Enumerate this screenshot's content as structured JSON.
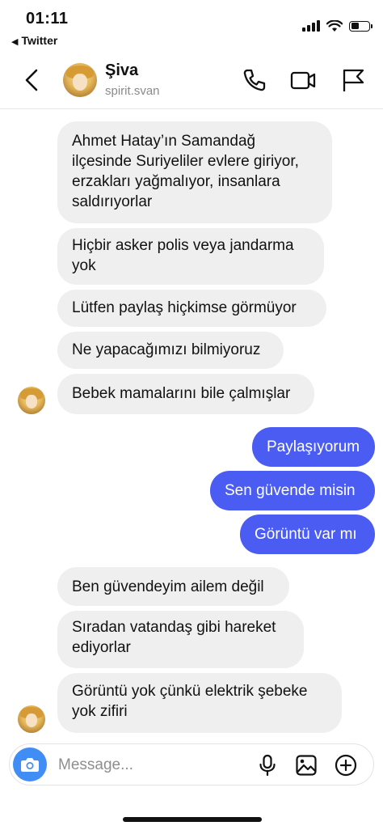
{
  "status_bar": {
    "time": "01:11",
    "back_app": "Twitter"
  },
  "header": {
    "name": "Şiva",
    "username": "spirit.svan",
    "icons": [
      "chevron-left-icon",
      "phone-icon",
      "video-icon",
      "flag-icon"
    ]
  },
  "messages": [
    {
      "direction": "in",
      "text": "Ahmet Hatay’ın Samandağ ilçesinde Suriyeliler evlere giriyor, erzakları yağmalıyor, insanlara saldırıyorlar"
    },
    {
      "direction": "in",
      "text": "Hiçbir asker polis veya jandarma yok"
    },
    {
      "direction": "in",
      "text": "Lütfen paylaş hiçkimse görmüyor"
    },
    {
      "direction": "in",
      "text": "Ne yapacağımızı bilmiyoruz"
    },
    {
      "direction": "in",
      "text": "Bebek mamalarını bile çalmışlar"
    },
    {
      "direction": "out",
      "text": "Paylaşıyorum"
    },
    {
      "direction": "out",
      "text": "Sen güvende misin"
    },
    {
      "direction": "out",
      "text": "Görüntü var mı"
    },
    {
      "direction": "in",
      "text": "Ben güvendeyim ailem değil"
    },
    {
      "direction": "in",
      "text": "Sıradan vatandaş gibi hareket ediyorlar"
    },
    {
      "direction": "in",
      "text": "Görüntü yok çünkü elektrik şebeke yok zifiri"
    }
  ],
  "composer": {
    "placeholder": "Message...",
    "icons": [
      "camera-icon",
      "microphone-icon",
      "gallery-icon",
      "add-icon"
    ]
  },
  "colors": {
    "outgoing_bubble": "#4a5cf2",
    "incoming_bubble": "#efefef",
    "camera_button": "#3f8df5"
  }
}
